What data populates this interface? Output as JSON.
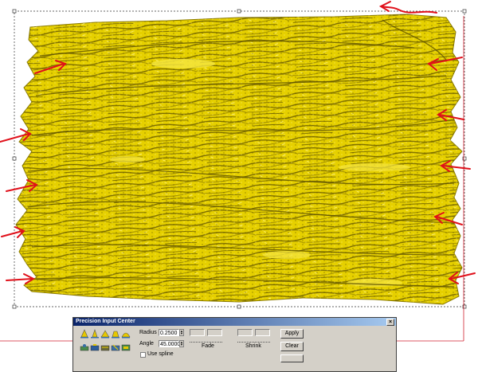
{
  "colors": {
    "relief": "#e6d000",
    "relief_dark": "#8a7a00",
    "annotation": "#e0101a",
    "selection": "#333333",
    "dialog_bg": "#d4d0c8",
    "title_bar": "#0a246a"
  },
  "dialog": {
    "title": "Precision Input Center",
    "radius_label": "Radius",
    "radius_value": "0.2500",
    "angle_label": "Angle",
    "angle_value": "45.0000",
    "use_spline_label": "Use spline",
    "fade_label": "Fade",
    "shrink_label": "Shrink",
    "apply_label": "Apply",
    "clear_label": "Clear",
    "close_icon": "close-icon"
  },
  "tools": {
    "row1": [
      "cone-sculpt-tool-icon",
      "cone-sharp-tool-icon",
      "cone-soft-tool-icon",
      "cone-flat-tool-icon",
      "cone-round-tool-icon"
    ],
    "row2": [
      "smooth-tool-icon",
      "stamp-tool-icon",
      "blend-tool-icon",
      "dig-tool-icon",
      "layer-tool-icon"
    ]
  }
}
